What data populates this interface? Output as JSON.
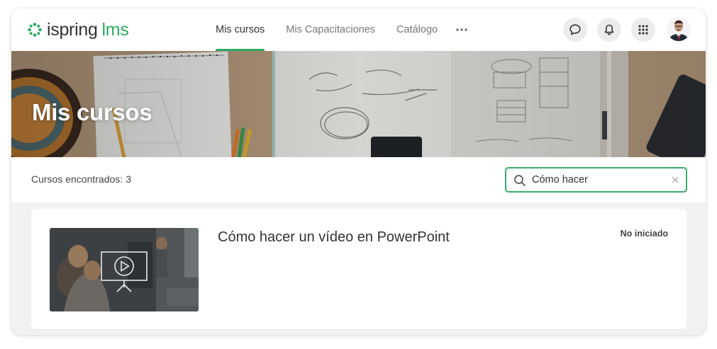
{
  "header": {
    "logo": {
      "brand": "ispring",
      "product": "lms"
    },
    "nav": [
      {
        "label": "Mis cursos",
        "active": true
      },
      {
        "label": "Mis Capacitaciones",
        "active": false
      },
      {
        "label": "Catálogo",
        "active": false
      }
    ],
    "icons": [
      "chat-icon",
      "bell-icon",
      "apps-grid-icon"
    ]
  },
  "banner": {
    "title": "Mis cursos"
  },
  "filter": {
    "found_label": "Cursos encontrados:",
    "found_count": "3",
    "search": {
      "value": "Cómo hacer",
      "placeholder": ""
    }
  },
  "courses": [
    {
      "title": "Cómo hacer un vídeo en PowerPoint",
      "status": "No iniciado"
    }
  ],
  "colors": {
    "accent": "#2eaa63",
    "text": "#333333",
    "muted": "#777777"
  }
}
